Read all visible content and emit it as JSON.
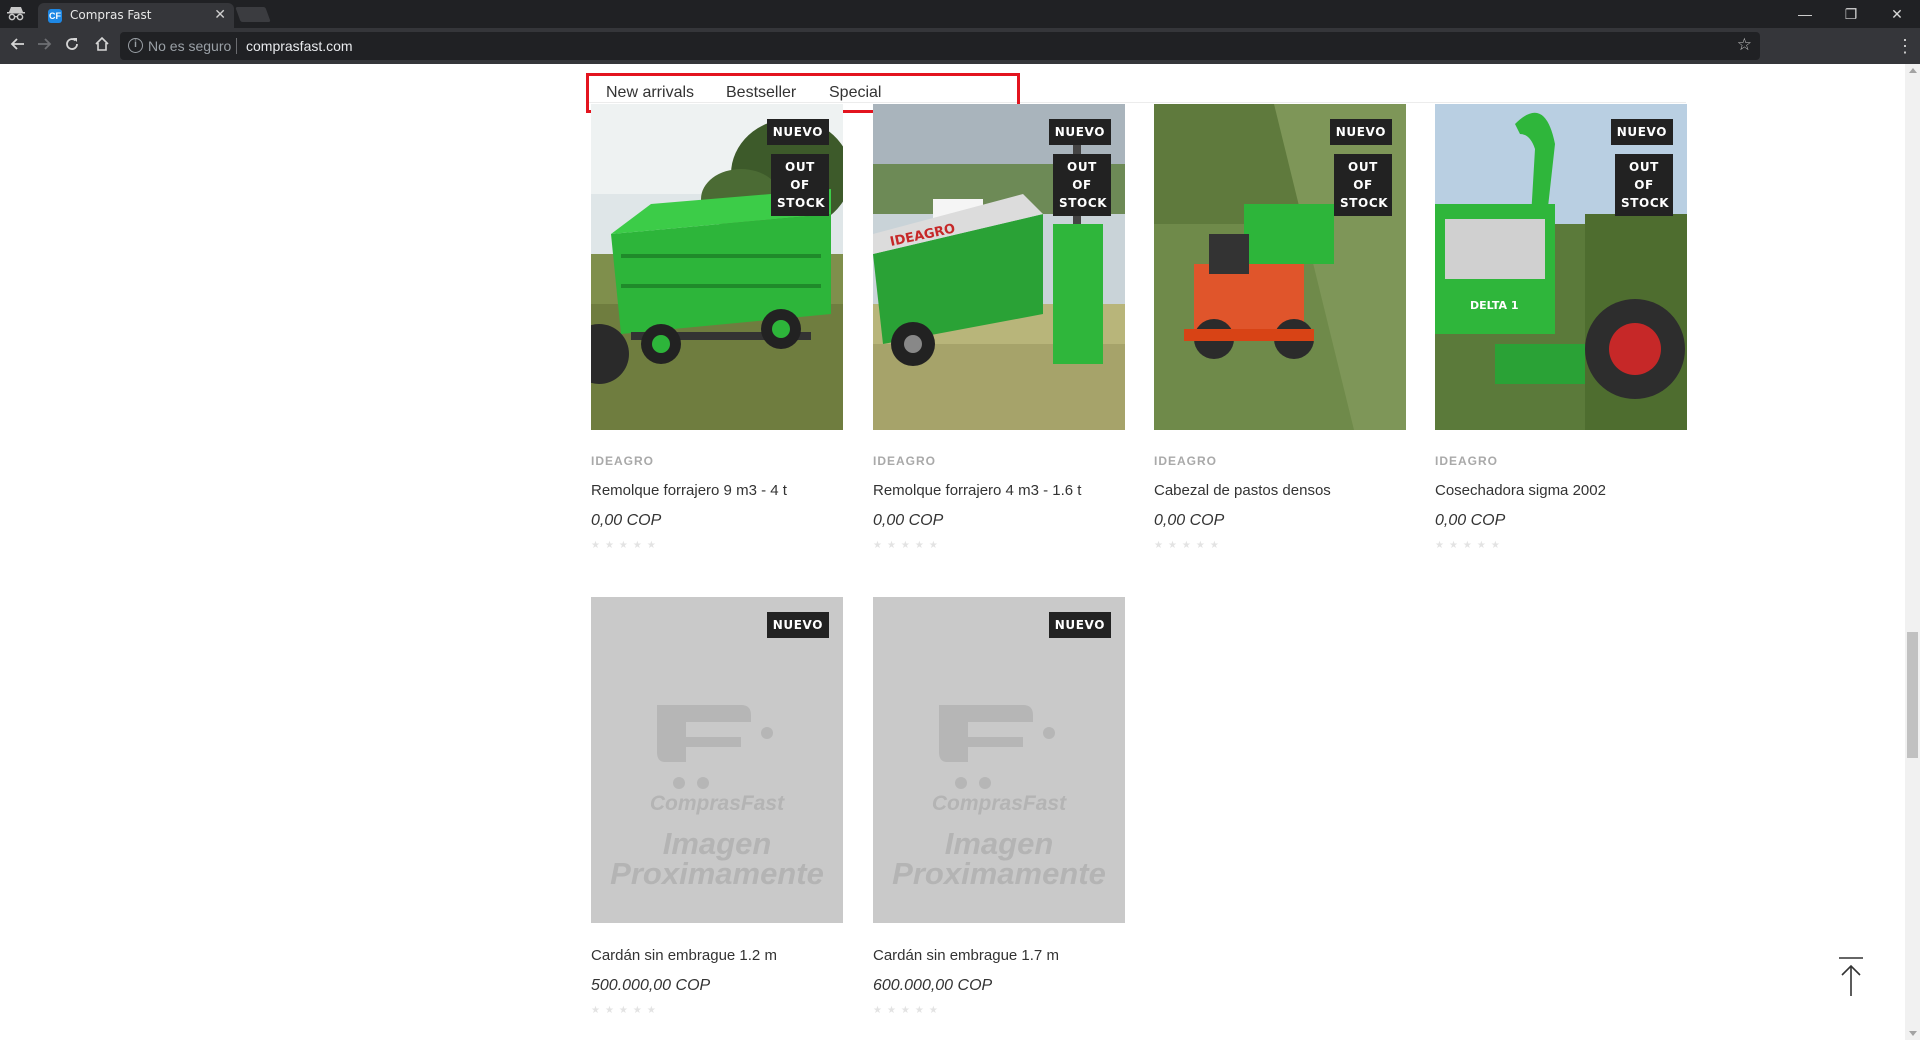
{
  "browser": {
    "tab_title": "Compras Fast",
    "tab_close": "✕",
    "security_label": "No es seguro",
    "url": "comprasfast.com",
    "window_controls": [
      "—",
      "❐",
      "✕"
    ]
  },
  "product_tabs": {
    "items": [
      "New arrivals",
      "Bestseller",
      "Special"
    ],
    "highlight_color": "#e3141f"
  },
  "products": [
    {
      "badges": [
        "NUEVO",
        "OUT OF STOCK"
      ],
      "brand": "IDEAGRO",
      "name": "Remolque forrajero 9 m3 - 4 t",
      "price": "0,00 COP",
      "image": "green-trailer-photo"
    },
    {
      "badges": [
        "NUEVO",
        "OUT OF STOCK"
      ],
      "brand": "IDEAGRO",
      "name": "Remolque forrajero 4 m3 - 1.6 t",
      "price": "0,00 COP",
      "image": "green-trailer-field-photo"
    },
    {
      "badges": [
        "NUEVO",
        "OUT OF STOCK"
      ],
      "brand": "IDEAGRO",
      "name": "Cabezal de pastos densos",
      "price": "0,00 COP",
      "image": "red-tractor-photo"
    },
    {
      "badges": [
        "NUEVO",
        "OUT OF STOCK"
      ],
      "brand": "IDEAGRO",
      "name": "Cosechadora sigma 2002",
      "price": "0,00 COP",
      "image": "green-harvester-photo"
    },
    {
      "badges": [
        "NUEVO"
      ],
      "brand": "",
      "name": "Cardán sin embrague 1.2 m",
      "price": "500.000,00 COP",
      "image": "placeholder-logo"
    },
    {
      "badges": [
        "NUEVO"
      ],
      "brand": "",
      "name": "Cardán sin embrague 1.7 m",
      "price": "600.000,00 COP",
      "image": "placeholder-logo"
    }
  ],
  "placeholder": {
    "logo_text": "ComprasFast",
    "line1": "Imagen",
    "line2": "Proximamente"
  },
  "stars": "★★★★★"
}
